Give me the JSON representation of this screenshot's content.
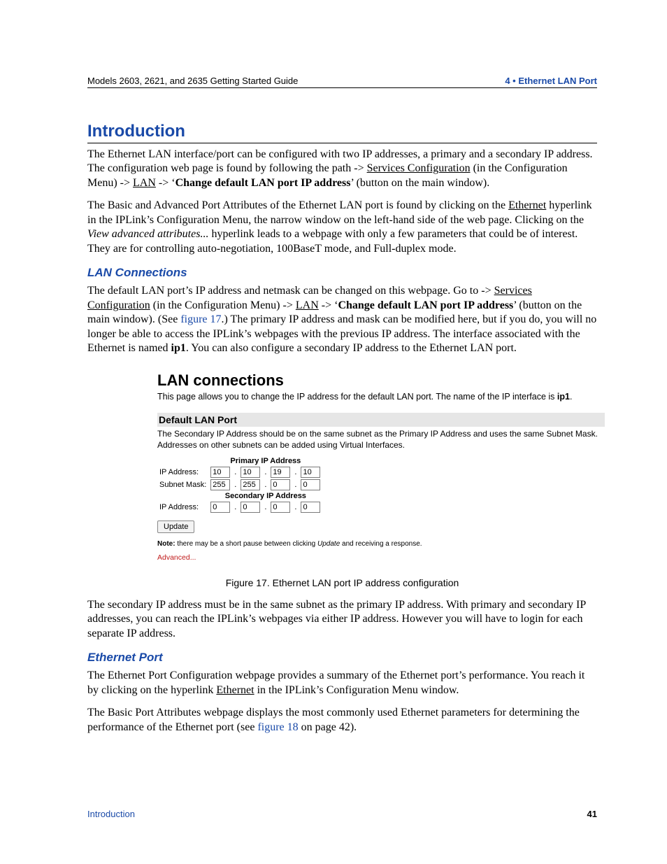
{
  "runhead": {
    "left": "Models 2603, 2621, and 2635 Getting Started Guide",
    "right": "4 • Ethernet LAN Port"
  },
  "h1": "Introduction",
  "intro": {
    "p1_a": "The Ethernet LAN interface/port can be configured with two IP addresses, a primary and a secondary IP address. The configuration web page is found by following the path -> ",
    "link_services": "Services Configuration",
    "p1_b": " (in the Configuration Menu) -> ",
    "link_lan": "LAN",
    "p1_c": " -> ‘",
    "bold1": "Change default LAN port IP address",
    "p1_d": "’ (button on the main window).",
    "p2_a": "The Basic and Advanced Port Attributes of the Ethernet LAN port is found by clicking on the ",
    "link_eth": "Ethernet",
    "p2_b": " hyperlink in the IPLink’s Configuration Menu, the narrow window on the left-hand side of the web page. Clicking on the ",
    "ital_view": "View advanced attributes...",
    "p2_c": " hyperlink leads to a webpage with only a few parameters that could be of interest. They are for controlling auto-negotiation, 100BaseT mode, and Full-duplex mode."
  },
  "lan": {
    "heading": "LAN Connections",
    "p_a": "The default LAN port’s IP address and netmask can be changed on this webpage. Go to -> ",
    "link_services": "Services Configuration",
    "p_b": " (in the Configuration Menu) -> ",
    "link_lan": "LAN",
    "p_c": " -> ‘",
    "bold1": "Change default LAN port IP address",
    "p_d": "’ (button on the main window). (See ",
    "figref": "figure 17",
    "p_e": ".) The primary IP address and mask can be modified here, but if you do, you will no longer be able to access the IPLink’s webpages with the previous IP address. The interface associated with the Ethernet is named ",
    "bold_ip1": "ip1",
    "p_f": ". You can also configure a secondary IP address to the Ethernet LAN port."
  },
  "figure": {
    "title": "LAN connections",
    "desc_a": "This page allows you to change the IP address for the default LAN port. The name of the IP interface is ",
    "desc_bold": "ip1",
    "desc_b": ".",
    "panel_head": "Default LAN Port",
    "panel_note": "The Secondary IP Address should be on the same subnet as the Primary IP Address and uses the same Subnet Mask. Addresses on other subnets can be added using Virtual Interfaces.",
    "group_primary": "Primary IP Address",
    "group_secondary": "Secondary IP Address",
    "row_ip": "IP Address:",
    "row_mask": "Subnet Mask:",
    "primary_ip": [
      "10",
      "10",
      "19",
      "10"
    ],
    "primary_mask": [
      "255",
      "255",
      "0",
      "0"
    ],
    "secondary_ip": [
      "0",
      "0",
      "0",
      "0"
    ],
    "update": "Update",
    "note_label": "Note:",
    "note_text": " there may be a short pause between clicking ",
    "note_ital": "Update",
    "note_text2": " and receiving a response.",
    "advanced": "Advanced...",
    "caption": "Figure 17. Ethernet LAN port IP address configuration"
  },
  "after_fig": "The secondary IP address must be in the same subnet as the primary IP address. With primary and secondary IP addresses, you can reach the IPLink’s webpages via either IP address. However you will have to login for each separate IP address.",
  "eth": {
    "heading": "Ethernet Port",
    "p1_a": "The Ethernet Port Configuration webpage provides a summary of the Ethernet port’s performance. You reach it by clicking on the hyperlink ",
    "link_eth": "Ethernet",
    "p1_b": " in the IPLink’s Configuration Menu window.",
    "p2_a": "The Basic Port Attributes webpage displays the most commonly used Ethernet parameters for determining the performance of the Ethernet port (see ",
    "figref": "figure 18",
    "p2_b": " on page 42)."
  },
  "footer": {
    "left": "Introduction",
    "right": "41"
  }
}
